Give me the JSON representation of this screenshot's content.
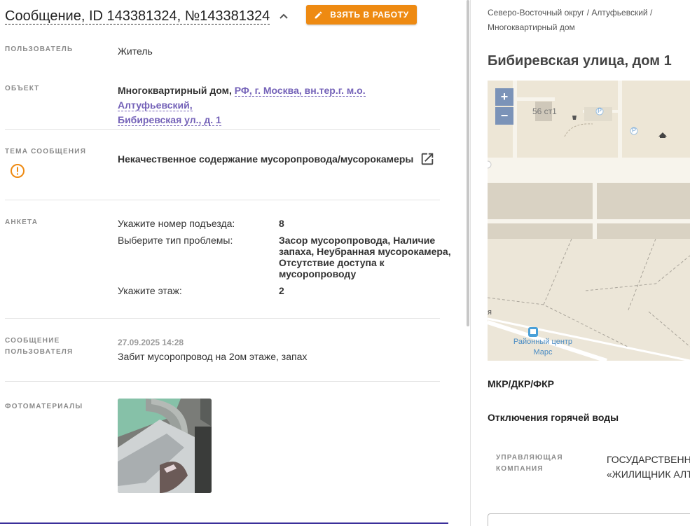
{
  "header": {
    "title": "Сообщение, ID 143381324, №143381324",
    "take_button": "ВЗЯТЬ В РАБОТУ"
  },
  "fields": {
    "user_label": "ПОЛЬЗОВАТЕЛЬ",
    "user_value": "Житель",
    "object_label": "ОБЪЕКТ",
    "object_type": "Многоквартирный дом,",
    "object_address_1": "РФ, г. Москва, вн.тер.г. м.о. Алтуфьевский,",
    "object_address_2": "Бибиревская ул., д. 1",
    "topic_label": "ТЕМА СООБЩЕНИЯ",
    "topic_value": "Некачественное содержание мусоропровода/мусорокамеры",
    "survey_label": "АНКЕТА",
    "survey": [
      {
        "q": "Укажите номер подъезда:",
        "a": "8"
      },
      {
        "q": "Выберите тип проблемы:",
        "a1": "Засор мусоропровода, Наличие",
        "a2": "запаха, Неубранная мусорокамера,",
        "a3": "Отсутствие доступа к",
        "a4": "мусоропроводу"
      },
      {
        "q": "Укажите этаж:",
        "a": "2"
      }
    ],
    "message_label_1": "СООБЩЕНИЕ",
    "message_label_2": "ПОЛЬЗОВАТЕЛЯ",
    "message_time": "27.09.2025 14:28",
    "message_text": "Забит мусоропровод на 2ом этаже, запах",
    "photos_label": "ФОТОМАТЕРИАЛЫ"
  },
  "right": {
    "breadcrumb_1": "Северо-Восточный округ / Алтуфьевский /",
    "breadcrumb_2": "Многоквартирный дом",
    "address": "Бибиревская улица, дом 1",
    "map": {
      "zoom_in": "+",
      "zoom_out": "−",
      "building_label": "56 ст1",
      "parking": "P",
      "poi_1": "Районный центр",
      "poi_2": "Марс",
      "edge_text": "я"
    },
    "section_1": "МКР/ДКР/ФКР",
    "section_2": "Отключения горячей воды",
    "mc_label_1": "УПРАВЛЯЮЩАЯ",
    "mc_label_2": "КОМПАНИЯ",
    "mc_value_1": "ГОСУДАРСТВЕННОЕ",
    "mc_value_2": "«ЖИЛИЩНИК АЛТ"
  },
  "colors": {
    "accent": "#ee8a12",
    "link": "#7462b8",
    "warning": "#ee8a12"
  }
}
